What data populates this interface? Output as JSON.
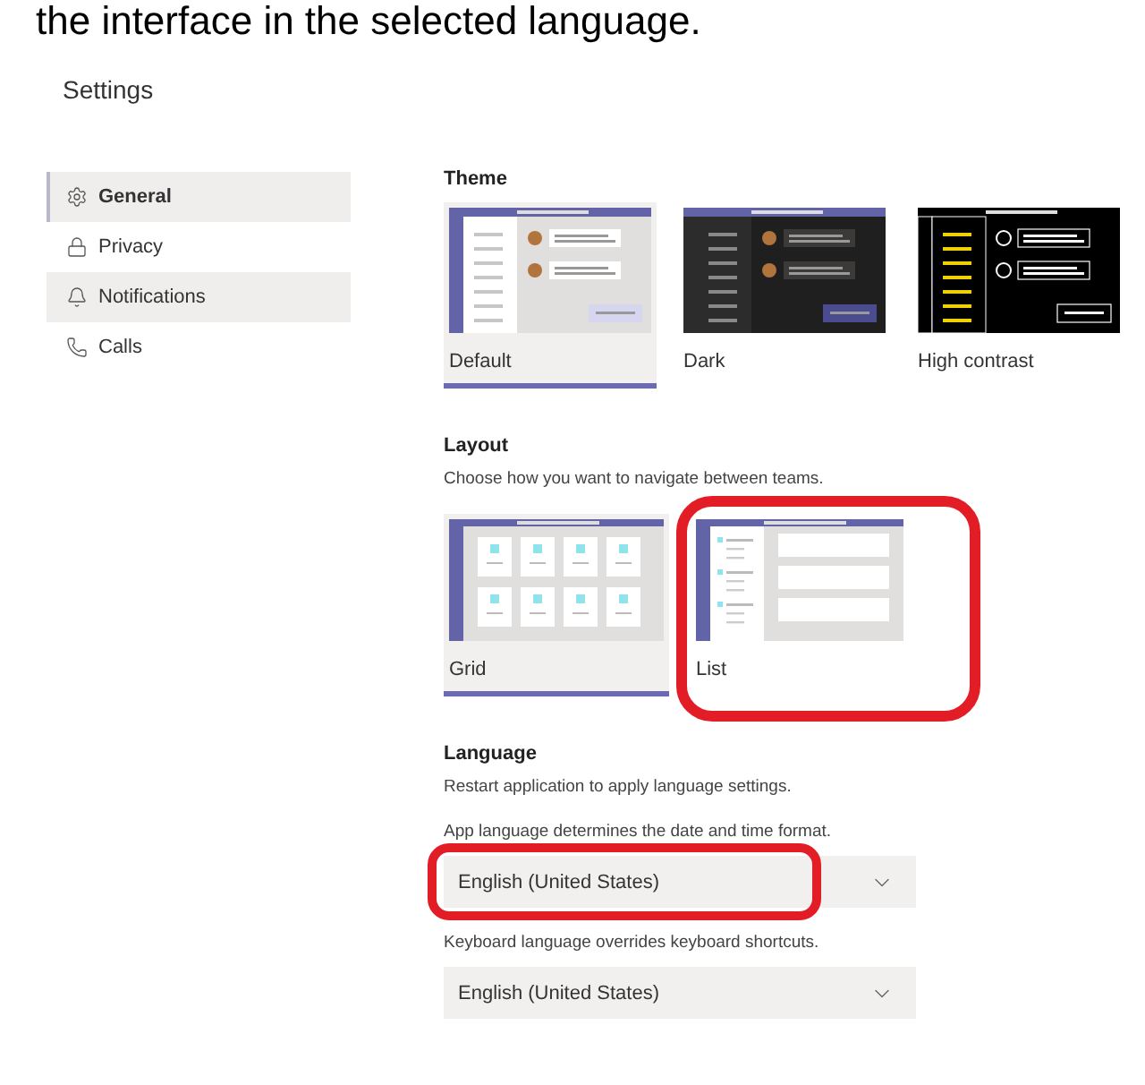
{
  "caption": "the interface in the selected language.",
  "window": {
    "title": "Settings"
  },
  "sidebar": {
    "items": [
      {
        "label": "General",
        "kind": "gear",
        "selected": true,
        "hovered": false
      },
      {
        "label": "Privacy",
        "kind": "lock",
        "selected": false,
        "hovered": false
      },
      {
        "label": "Notifications",
        "kind": "bell",
        "selected": false,
        "hovered": true
      },
      {
        "label": "Calls",
        "kind": "phone",
        "selected": false,
        "hovered": false
      }
    ]
  },
  "theme": {
    "heading": "Theme",
    "options": [
      {
        "label": "Default",
        "kind": "default",
        "selected": true
      },
      {
        "label": "Dark",
        "kind": "dark",
        "selected": false
      },
      {
        "label": "High contrast",
        "kind": "high_contrast",
        "selected": false
      }
    ]
  },
  "layout": {
    "heading": "Layout",
    "description": "Choose how you want to navigate between teams.",
    "options": [
      {
        "label": "Grid",
        "kind": "grid",
        "selected": true,
        "annotated": false
      },
      {
        "label": "List",
        "kind": "list",
        "selected": false,
        "annotated": true
      }
    ]
  },
  "language": {
    "heading": "Language",
    "note": "Restart application to apply language settings.",
    "fields": [
      {
        "label": "App language determines the date and time format.",
        "value": "English (United States)",
        "annotated": true
      },
      {
        "label": "Keyboard language overrides keyboard shortcuts.",
        "value": "English (United States)",
        "annotated": false
      }
    ]
  }
}
